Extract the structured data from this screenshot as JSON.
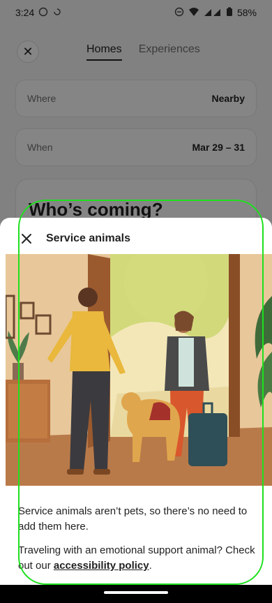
{
  "status": {
    "time": "3:24",
    "battery": "58%"
  },
  "header": {
    "close_icon": "close-icon",
    "tabs": [
      {
        "label": "Homes",
        "active": true
      },
      {
        "label": "Experiences",
        "active": false
      }
    ]
  },
  "search": {
    "where": {
      "label": "Where",
      "value": "Nearby"
    },
    "when": {
      "label": "When",
      "value": "Mar 29 – 31"
    },
    "who_title": "Who’s coming?"
  },
  "sheet": {
    "title": "Service animals",
    "paragraph1": "Service animals aren’t pets, so there’s no need to add them here.",
    "paragraph2_prefix": "Traveling with an emotional support animal? Check out our ",
    "link_text": "accessibility policy",
    "paragraph2_suffix": "."
  },
  "colors": {
    "outline": "#1ee01e",
    "text": "#222222",
    "muted": "#717171"
  }
}
